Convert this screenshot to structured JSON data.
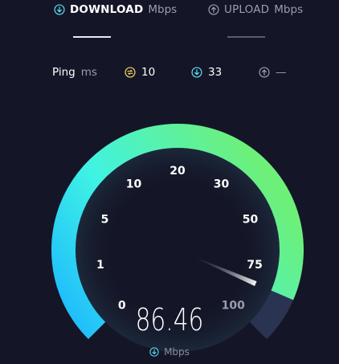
{
  "tabs": {
    "download": {
      "label": "DOWNLOAD",
      "unit": "Mbps"
    },
    "upload": {
      "label": "UPLOAD",
      "unit": "Mbps"
    }
  },
  "ping": {
    "label": "Ping",
    "unit": "ms",
    "jitter": "10",
    "download": "33",
    "upload": "—"
  },
  "gauge": {
    "ticks": [
      "0",
      "1",
      "5",
      "10",
      "20",
      "30",
      "50",
      "75",
      "100"
    ],
    "current_value": "86.46",
    "unit": "Mbps",
    "needle_fraction": 0.92
  },
  "colors": {
    "background": "#141627",
    "gradient_start": "#1cb7ff",
    "gradient_mid": "#3ff3e4",
    "gradient_end": "#6df07a",
    "jitter_icon": "#f4d663",
    "download_icon": "#5bdcf5"
  }
}
